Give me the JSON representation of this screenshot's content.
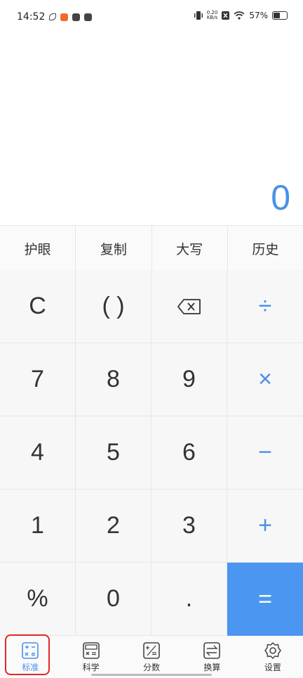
{
  "status": {
    "time": "14:52",
    "net_speed_value": "0.20",
    "net_speed_unit": "KB/s",
    "battery": "57%",
    "battery_level": 0.57
  },
  "display": {
    "result": "0"
  },
  "toolbar": [
    "护眼",
    "复制",
    "大写",
    "历史"
  ],
  "keys": [
    {
      "label": "C",
      "type": "fn",
      "name": "clear-button"
    },
    {
      "label": "( )",
      "type": "fn",
      "name": "parentheses-button"
    },
    {
      "label": "",
      "type": "fn",
      "name": "backspace-button",
      "icon": "backspace-icon"
    },
    {
      "label": "÷",
      "type": "op",
      "name": "divide-button"
    },
    {
      "label": "7",
      "type": "num",
      "name": "digit-7-button"
    },
    {
      "label": "8",
      "type": "num",
      "name": "digit-8-button"
    },
    {
      "label": "9",
      "type": "num",
      "name": "digit-9-button"
    },
    {
      "label": "×",
      "type": "op",
      "name": "multiply-button"
    },
    {
      "label": "4",
      "type": "num",
      "name": "digit-4-button"
    },
    {
      "label": "5",
      "type": "num",
      "name": "digit-5-button"
    },
    {
      "label": "6",
      "type": "num",
      "name": "digit-6-button"
    },
    {
      "label": "−",
      "type": "op",
      "name": "minus-button"
    },
    {
      "label": "1",
      "type": "num",
      "name": "digit-1-button"
    },
    {
      "label": "2",
      "type": "num",
      "name": "digit-2-button"
    },
    {
      "label": "3",
      "type": "num",
      "name": "digit-3-button"
    },
    {
      "label": "+",
      "type": "op",
      "name": "plus-button"
    },
    {
      "label": "%",
      "type": "num",
      "name": "percent-button"
    },
    {
      "label": "0",
      "type": "num",
      "name": "digit-0-button"
    },
    {
      "label": ".",
      "type": "num",
      "name": "decimal-button"
    },
    {
      "label": "=",
      "type": "eq",
      "name": "equals-button"
    }
  ],
  "tabs": [
    {
      "label": "标准",
      "icon": "standard-calc-icon",
      "active": true
    },
    {
      "label": "科学",
      "icon": "scientific-calc-icon",
      "active": false
    },
    {
      "label": "分数",
      "icon": "fraction-calc-icon",
      "active": false
    },
    {
      "label": "换算",
      "icon": "conversion-icon",
      "active": false
    },
    {
      "label": "设置",
      "icon": "settings-gear-icon",
      "active": false
    }
  ],
  "colors": {
    "accent": "#4a90e8",
    "equals_bg": "#4a96f0",
    "highlight": "#e22828"
  }
}
